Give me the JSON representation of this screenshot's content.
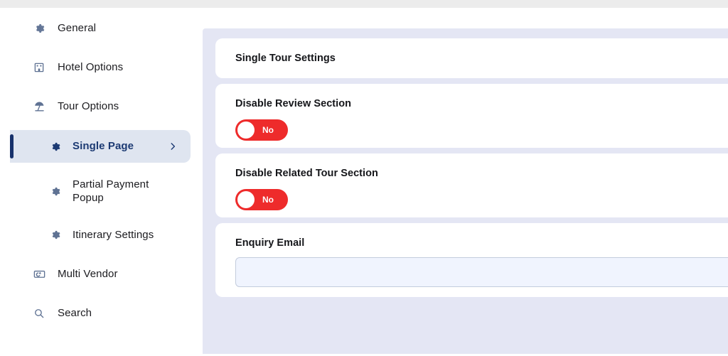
{
  "sidebar": {
    "items": [
      {
        "label": "General",
        "icon": "gear-icon",
        "level": "top",
        "active": false
      },
      {
        "label": "Hotel Options",
        "icon": "building-icon",
        "level": "top",
        "active": false
      },
      {
        "label": "Tour Options",
        "icon": "beach-umbrella-icon",
        "level": "top",
        "active": false
      },
      {
        "label": "Single Page",
        "icon": "gear-icon",
        "level": "sub",
        "active": true,
        "chevron": "chevron-right-icon"
      },
      {
        "label": "Partial Payment Popup",
        "icon": "gear-icon",
        "level": "sub",
        "active": false
      },
      {
        "label": "Itinerary Settings",
        "icon": "gear-icon",
        "level": "sub",
        "active": false
      },
      {
        "label": "Multi Vendor",
        "icon": "multi-vendor-icon",
        "level": "top",
        "active": false
      },
      {
        "label": "Search",
        "icon": "search-icon",
        "level": "top",
        "active": false
      }
    ]
  },
  "main": {
    "section_title": "Single Tour Settings",
    "settings": [
      {
        "label": "Disable Review Section",
        "control": "toggle",
        "value": "No",
        "enabled": false
      },
      {
        "label": "Disable Related Tour Section",
        "control": "toggle",
        "value": "No",
        "enabled": false
      }
    ],
    "enquiry_email": {
      "label": "Enquiry Email",
      "value": "",
      "placeholder": ""
    }
  },
  "colors": {
    "toggle_off": "#ee2b2b",
    "content_bg": "#e4e6f4",
    "active_nav_bg": "#dfe5f0",
    "active_nav_text": "#1c3a73",
    "active_indicator": "#17316b",
    "input_bg": "#f0f4fe",
    "input_border": "#c3ccdd"
  }
}
